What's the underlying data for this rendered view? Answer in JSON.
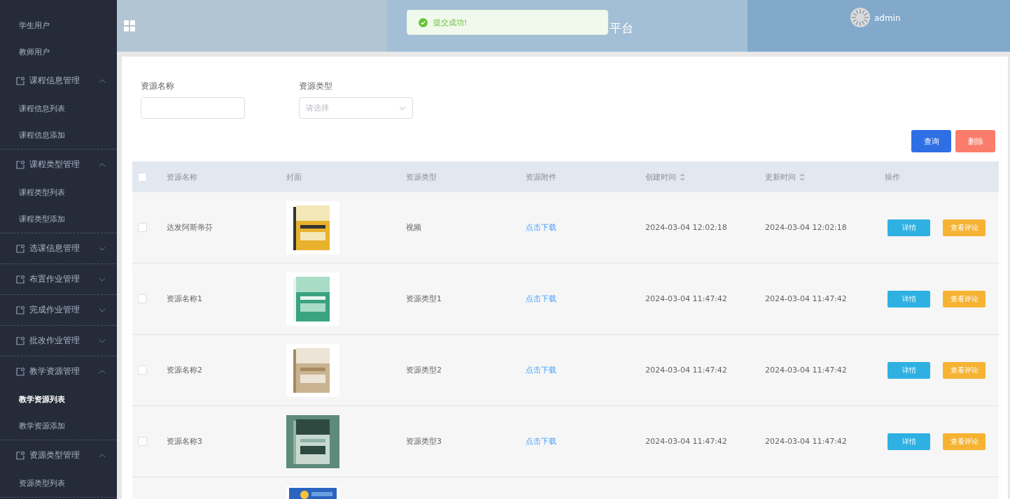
{
  "sidebar": {
    "items": [
      {
        "kind": "link",
        "label": "学生用户",
        "selected": false
      },
      {
        "kind": "link",
        "label": "教师用户",
        "selected": false
      },
      {
        "kind": "group",
        "label": "课程信息管理",
        "expanded": true,
        "children": [
          {
            "label": "课程信息列表",
            "selected": false
          },
          {
            "label": "课程信息添加",
            "selected": false
          }
        ]
      },
      {
        "kind": "group",
        "label": "课程类型管理",
        "expanded": true,
        "children": [
          {
            "label": "课程类型列表",
            "selected": false
          },
          {
            "label": "课程类型添加",
            "selected": false
          }
        ]
      },
      {
        "kind": "group",
        "label": "选课信息管理",
        "expanded": false
      },
      {
        "kind": "group",
        "label": "布置作业管理",
        "expanded": false
      },
      {
        "kind": "group",
        "label": "完成作业管理",
        "expanded": false
      },
      {
        "kind": "group",
        "label": "批改作业管理",
        "expanded": false
      },
      {
        "kind": "group",
        "label": "教学资源管理",
        "expanded": true,
        "children": [
          {
            "label": "教学资源列表",
            "selected": true
          },
          {
            "label": "教学资源添加",
            "selected": false
          }
        ]
      },
      {
        "kind": "group",
        "label": "资源类型管理",
        "expanded": true,
        "children": [
          {
            "label": "资源类型列表",
            "selected": false
          }
        ]
      }
    ]
  },
  "header": {
    "title": "平台",
    "user": "admin"
  },
  "toast": {
    "message": "提交成功!"
  },
  "filters": [
    {
      "kind": "input",
      "label": "资源名称"
    },
    {
      "kind": "select",
      "label": "资源类型",
      "placeholder": "请选择"
    }
  ],
  "actions": [
    {
      "label": "查询",
      "kind": "primary"
    },
    {
      "label": "删除",
      "kind": "danger"
    }
  ],
  "table": {
    "select_all_checked": false,
    "columns": [
      {
        "label": "资源名称",
        "sortable": false
      },
      {
        "label": "封面",
        "sortable": false
      },
      {
        "label": "资源类型",
        "sortable": false
      },
      {
        "label": "资源附件",
        "sortable": false
      },
      {
        "label": "创建时间",
        "sortable": true
      },
      {
        "label": "更新时间",
        "sortable": true
      },
      {
        "label": "操作",
        "sortable": false
      }
    ],
    "rows": [
      {
        "checked": false,
        "name": "达发阿斯蒂芬",
        "type": "视频",
        "attachment": "点击下载",
        "created": "2024-03-04 12:02:18",
        "updated": "2024-03-04 12:02:18",
        "buttons": [
          "详情",
          "查看评论"
        ]
      },
      {
        "checked": false,
        "name": "资源名称1",
        "type": "资源类型1",
        "attachment": "点击下载",
        "created": "2024-03-04 11:47:42",
        "updated": "2024-03-04 11:47:42",
        "buttons": [
          "详情",
          "查看评论"
        ]
      },
      {
        "checked": false,
        "name": "资源名称2",
        "type": "资源类型2",
        "attachment": "点击下载",
        "created": "2024-03-04 11:47:42",
        "updated": "2024-03-04 11:47:42",
        "buttons": [
          "详情",
          "查看评论"
        ]
      },
      {
        "checked": false,
        "name": "资源名称3",
        "type": "资源类型3",
        "attachment": "点击下载",
        "created": "2024-03-04 11:47:42",
        "updated": "2024-03-04 11:47:42",
        "buttons": [
          "详情",
          "查看评论"
        ]
      }
    ]
  }
}
